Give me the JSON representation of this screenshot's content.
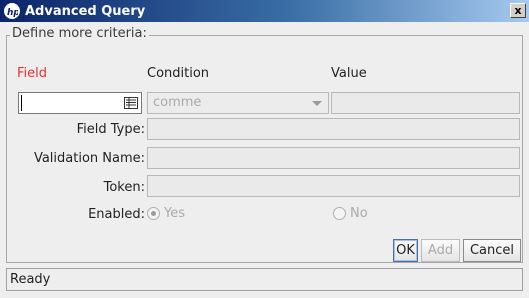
{
  "window": {
    "title": "Advanced Query",
    "close_label": "x"
  },
  "group": {
    "legend": "Define more criteria:"
  },
  "headers": {
    "field": "Field",
    "condition": "Condition",
    "value": "Value"
  },
  "criteria": {
    "field_value": "",
    "condition_value": "comme",
    "value_value": ""
  },
  "labels": {
    "field_type": "Field Type:",
    "validation_name": "Validation Name:",
    "token": "Token:",
    "enabled": "Enabled:"
  },
  "enabled_options": {
    "yes": "Yes",
    "no": "No",
    "selected": "Yes"
  },
  "buttons": {
    "ok": "OK",
    "add": "Add",
    "cancel": "Cancel"
  },
  "status": {
    "text": "Ready"
  },
  "colors": {
    "title_gradient_start": "#0a246a",
    "title_gradient_end": "#a6caf0",
    "field_header": "#e8302f"
  },
  "icons": {
    "app": "hp-logo-icon",
    "picker": "list-picker-icon",
    "dropdown": "chevron-down-icon",
    "close": "close-icon"
  }
}
